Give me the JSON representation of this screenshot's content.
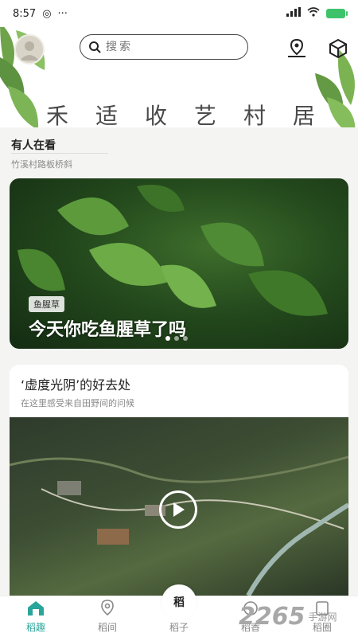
{
  "status_bar": {
    "time": "8:57",
    "menu_dots": "···"
  },
  "header": {
    "search_placeholder": "搜索",
    "calligraphy": [
      "禾",
      "适",
      "收",
      "艺",
      "村",
      "居"
    ]
  },
  "section_watching": {
    "title": "有人在看",
    "subtitle": "竹溪村路板桥斜",
    "photo_tag": "鱼腥草",
    "photo_caption": "今天你吃鱼腥草了吗",
    "carousel_pages": 3,
    "carousel_active": 0
  },
  "section_getaway": {
    "title": "‘虚度光阴’的好去处",
    "subtitle": "在这里感受来自田野间的问候"
  },
  "bottom_nav": {
    "items": [
      {
        "label": "稻趣",
        "icon": "home-icon"
      },
      {
        "label": "稻间",
        "icon": "location-icon"
      },
      {
        "label": "稻子",
        "icon": "rice-icon"
      },
      {
        "label": "稻香",
        "icon": "fragrance-icon"
      },
      {
        "label": "稻圈",
        "icon": "circle-icon"
      }
    ],
    "center_mark": "稻",
    "active_color": "#2aa59b"
  },
  "watermark": {
    "number": "2265",
    "suffix": "手游网"
  }
}
